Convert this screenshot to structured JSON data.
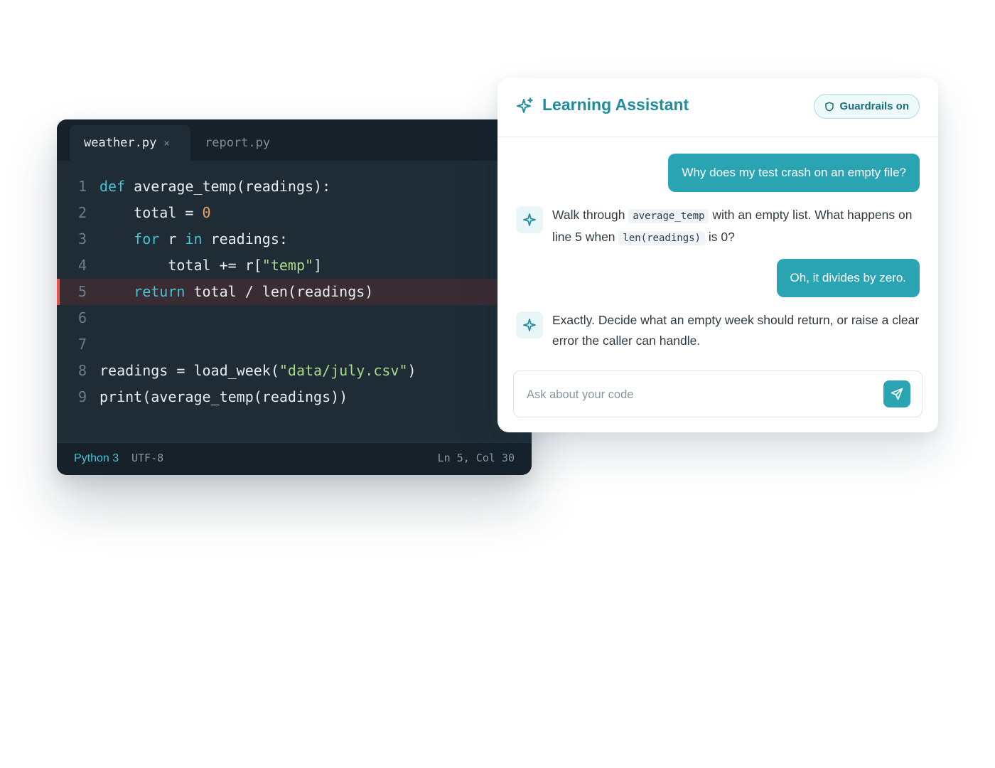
{
  "editor": {
    "tabs": [
      {
        "label": "weather.py",
        "close": "×",
        "active": true
      },
      {
        "label": "report.py",
        "active": false
      }
    ],
    "lines": [
      {
        "n": "1",
        "t": [
          [
            "kw",
            "def"
          ],
          [
            "p",
            " average_temp(readings):"
          ]
        ]
      },
      {
        "n": "2",
        "t": [
          [
            "p",
            "    total = "
          ],
          [
            "num",
            "0"
          ]
        ]
      },
      {
        "n": "3",
        "t": [
          [
            "p",
            "    "
          ],
          [
            "kw",
            "for"
          ],
          [
            "p",
            " r "
          ],
          [
            "kw",
            "in"
          ],
          [
            "p",
            " readings:"
          ]
        ]
      },
      {
        "n": "4",
        "t": [
          [
            "p",
            "        total += r["
          ],
          [
            "str",
            "\"temp\""
          ],
          [
            "p",
            "]"
          ]
        ]
      },
      {
        "n": "5",
        "t": [
          [
            "p",
            "    "
          ],
          [
            "kw",
            "return"
          ],
          [
            "p",
            " total / len(readings)"
          ]
        ],
        "error": true
      },
      {
        "n": "6",
        "t": []
      },
      {
        "n": "7",
        "t": []
      },
      {
        "n": "8",
        "t": [
          [
            "p",
            "readings = load_week("
          ],
          [
            "str",
            "\"data/july.csv\""
          ],
          [
            "p",
            ")"
          ]
        ]
      },
      {
        "n": "9",
        "t": [
          [
            "p",
            "print(average_temp(readings))"
          ]
        ]
      }
    ],
    "status": {
      "language": "Python 3",
      "encoding": "UTF-8",
      "position": "Ln 5, Col 30"
    }
  },
  "assistant": {
    "title": "Learning Assistant",
    "badge": "Guardrails on",
    "messages": [
      {
        "role": "user",
        "text": "Why does my test crash on an empty file?"
      },
      {
        "role": "assistant",
        "parts": [
          [
            "t",
            "Walk through "
          ],
          [
            "c",
            "average_temp"
          ],
          [
            "t",
            " with an empty list. What happens on line 5 when "
          ],
          [
            "c",
            "len(readings)"
          ],
          [
            "t",
            " is 0?"
          ]
        ]
      },
      {
        "role": "user",
        "text": "Oh, it divides by zero."
      },
      {
        "role": "assistant",
        "parts": [
          [
            "t",
            "Exactly. Decide what an empty week should return, or raise a clear error the caller can handle."
          ]
        ]
      }
    ],
    "input_placeholder": "Ask about your code",
    "icons": {
      "header": "sparkle-icon",
      "badge": "shield-icon",
      "avatar": "sparkle-icon",
      "send": "send-icon"
    }
  },
  "colors": {
    "accent": "#2aa3b3",
    "title": "#1f8d9b",
    "editor_bg": "#1f2c35",
    "keyword": "#45c3d3",
    "number": "#e9a15a",
    "string": "#a8d98c",
    "error": "#e5534b"
  }
}
